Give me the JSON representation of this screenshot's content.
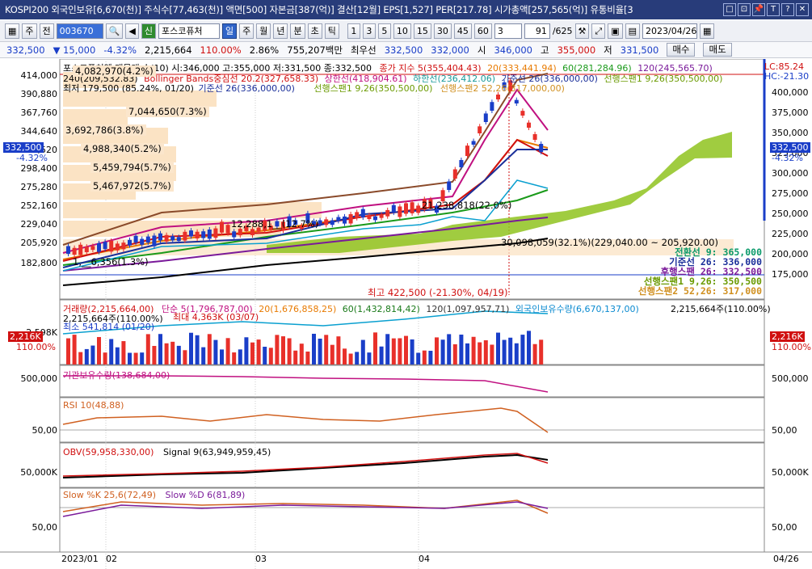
{
  "titlebar": {
    "title": "KOSPI200 외국인보유[6,670(천)] 주식수[77,463(천)] 액면[500] 자본금[387(억)] 결산[12월] EPS[1,527] PER[217.78] 시가총액[257,565(억)] 유통비율[3",
    "buttons": [
      "□",
      "⊡",
      "📌",
      "T",
      "?",
      "✕"
    ]
  },
  "toolbar": {
    "period_a": "주",
    "period_b": "전",
    "code": "003670",
    "stock_badge": "신",
    "stock_name": "포스코퓨처",
    "periods": [
      "일",
      "주",
      "월",
      "년",
      "분",
      "초",
      "틱"
    ],
    "active_period": "일",
    "intervals": [
      "1",
      "3",
      "5",
      "10",
      "15",
      "30",
      "45",
      "60"
    ],
    "interval_value": "3",
    "page": "91",
    "page_total": "/625",
    "date": "2023/04/26"
  },
  "quotebar": {
    "price": "332,500",
    "change": "▼ 15,000",
    "change_pct": "-4.32%",
    "volume": "2,215,664",
    "vol_ratio": "110.00%",
    "turnover": "2.86%",
    "amount": "755,207백만",
    "best": "최우선",
    "best_ask": "332,500",
    "best_bid": "332,000",
    "open_label": "시",
    "open": "346,000",
    "high_label": "고",
    "high": "355,000",
    "low_label": "저",
    "low": "331,500",
    "buy": "매수",
    "sell": "매도"
  },
  "colors": {
    "up": "#e8302a",
    "down": "#1a3ec8",
    "cloud": "#8fc31f",
    "accent": "#283c7a"
  },
  "price_panel": {
    "header_a": "포스코퓨처엠 매물대 수(10)  시:346,000 고:355,000 저:331,500 종:332,500",
    "header_b": "종가 지수 5(355,404.43)",
    "header_c": "20(333,441.94)",
    "header_d": "60(281,284.96)",
    "header_e": "120(245,565.70)",
    "line2_a": "240(209,532.83)",
    "line2_b": "Bollinger Bands중심선 20.2(327,658.33)",
    "line2_c": "상한선(418,904.61)",
    "line2_d": "하한선(236,412.06)",
    "line2_e": "기준선 26(336,000,00)",
    "line2_f": "선행스팬1 9,26(350,500,00)",
    "line3_a": "최저 179,500 (85.24%, 01/20)",
    "line3_b": "기준선 26(336,000,00)",
    "line3_c": "선행스팬1 9,26(350,500,00)",
    "line3_d": "선행스팬2 52,26(317,000,00)",
    "lc": "LC:85.24",
    "hc": "HC:-21.30",
    "yticks": [
      "414,000",
      "390,880",
      "367,760",
      "344,640",
      "321,520",
      "298,400",
      "275,280",
      "252,160",
      "229,040",
      "205,920",
      "182,800"
    ],
    "yticks_right": [
      "400,000",
      "375,000",
      "350,000",
      "325,000",
      "300,000",
      "275,000",
      "250,000",
      "225,000",
      "200,000",
      "175,000"
    ],
    "price_badge": "332,500",
    "price_pct": "-4.32%",
    "vp_labels": [
      "4,082,970(4.2%)",
      "7,044,650(7.3%)",
      "3,692,786(3.8%)",
      "4,988,340(5.2%)",
      "5,459,794(5.7%)",
      "5,467,972(5.7%)",
      "12,288,1__(12.7%)",
      "21,238,818(22.0%)",
      "30,098,059(32.1%)(229,040.00 ~ 205,920.00)",
      "1,__6,356(1.3%)"
    ],
    "ichimoku": [
      {
        "label": "전환선 9: 365,000",
        "color": "#0a9a6a"
      },
      {
        "label": "기준선 26: 336,000",
        "color": "#1a2f9a"
      },
      {
        "label": "후행스팬 26: 332,500",
        "color": "#7a1a9a"
      },
      {
        "label": "선행스팬1 9,26: 350,500",
        "color": "#6a9a00"
      },
      {
        "label": "선행스팬2 52,26: 317,000",
        "color": "#d09020"
      }
    ],
    "high_note": "최고 422,500 (-21.30%, 04/19)"
  },
  "volume_panel": {
    "legend_a": "거래량(2,215,664,00)",
    "legend_b": "단순 5(1,796,787,00)",
    "legend_c": "20(1,676,858,25)",
    "legend_d": "60(1,432,814,42)",
    "legend_e": "120(1,097,957,71)",
    "legend_f": "외국인보유수량(6,670,137,00)",
    "right_value": "2,215,664주(110.00%)",
    "line2": "2,215,664주(110.00%)",
    "line3": "최대 4,363K (03/07)",
    "line4": "최소 541,814 (01/20)",
    "y_left": "2,598K",
    "badge_left": "2,216K",
    "badge_left_pct": "110.00%",
    "badge_right": "2,216K",
    "badge_right_pct": "110.00%"
  },
  "inst_panel": {
    "legend": "기관보유수량(138,684,00)",
    "y_left": "500,000",
    "y_right": "500,000"
  },
  "rsi_panel": {
    "legend": "RSI 10(48,88)",
    "y_left": "50,00",
    "y_right": "50,00"
  },
  "obv_panel": {
    "legend_a": "OBV(59,958,330,00)",
    "legend_b": "Signal 9(63,949,959,45)",
    "y_left": "50,000K",
    "y_right": "50,000K"
  },
  "stoch_panel": {
    "legend_a": "Slow %K 25,6(72,49)",
    "legend_b": "Slow %D 6(81,89)",
    "y_left": "50,00",
    "y_right": "50,00"
  },
  "xaxis": {
    "labels": [
      "2023/01",
      "02",
      "03",
      "04"
    ],
    "right_date": "04/26"
  }
}
